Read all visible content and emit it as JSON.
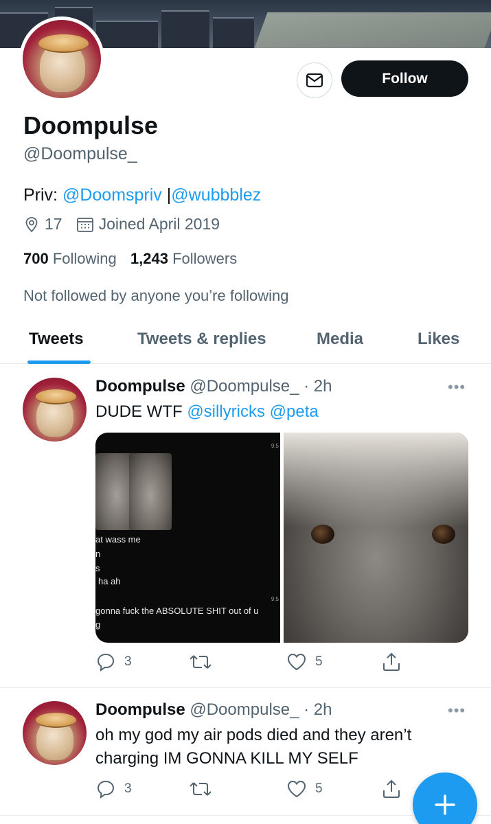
{
  "profile": {
    "name": "Doompulse",
    "handle": "@Doompulse_",
    "follow_label": "Follow",
    "bio_prefix": "Priv: ",
    "bio_link1": "@Doomspriv",
    "bio_sep": " |",
    "bio_link2": "@wubbblez",
    "location": "17",
    "joined": "Joined April 2019",
    "following_count": "700",
    "following_label": "Following",
    "followers_count": "1,243",
    "followers_label": "Followers",
    "not_followed": "Not followed by anyone you’re following"
  },
  "tabs": [
    {
      "label": "Tweets"
    },
    {
      "label": "Tweets & replies"
    },
    {
      "label": "Media"
    },
    {
      "label": "Likes"
    }
  ],
  "tweets": [
    {
      "name": "Doompulse",
      "handle": "@Doompulse_",
      "time": " · 2h",
      "text_prefix": "DUDE WTF ",
      "mention1": "@sillyricks",
      "mention2": " @peta",
      "media_text": {
        "line1": "at wass me",
        "line2": "n",
        "line3": "s",
        "line4": "ha ah",
        "line5": "gonna fuck the ABSOLUTE SHIT out of u",
        "line6": "g",
        "time1": "9:5",
        "time2": "9:5"
      },
      "replies": "3",
      "likes": "5"
    },
    {
      "name": "Doompulse",
      "handle": "@Doompulse_",
      "time": " · 2h",
      "text": "oh my god my air pods died and they aren’t charging IM GONNA KILL MY SELF",
      "replies": "3",
      "likes": "5"
    }
  ],
  "icons": {
    "message": "envelope-icon",
    "location": "location-pin-icon",
    "calendar": "calendar-icon",
    "reply": "reply-icon",
    "retweet": "retweet-icon",
    "like": "heart-icon",
    "share": "share-icon",
    "compose": "plus-icon"
  },
  "colors": {
    "accent": "#1d9bf0",
    "text": "#0f1419",
    "muted": "#536471"
  }
}
